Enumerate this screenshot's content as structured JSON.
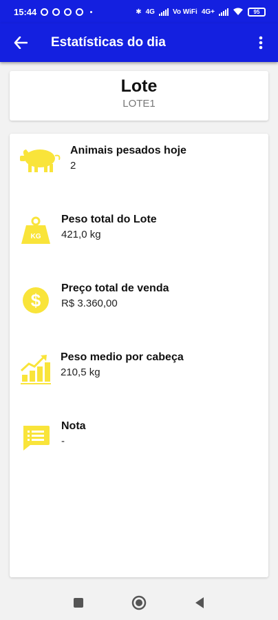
{
  "status_bar": {
    "time": "15:44",
    "network_labels": [
      "4G",
      "Vo WiFi",
      "4G+"
    ],
    "battery": "95"
  },
  "app_bar": {
    "title": "Estatísticas do dia",
    "back_icon": "arrow-left-icon",
    "menu_icon": "more-vert-icon"
  },
  "header_card": {
    "title": "Lote",
    "subtitle": "LOTE1"
  },
  "stats": [
    {
      "icon": "pig-icon",
      "label": "Animais pesados hoje",
      "value": "2"
    },
    {
      "icon": "weight-kg-icon",
      "label": "Peso total do Lote",
      "value": "421,0 kg"
    },
    {
      "icon": "dollar-coin-icon",
      "label": "Preço total de venda",
      "value": "R$ 3.360,00"
    },
    {
      "icon": "growth-chart-icon",
      "label": "Peso medio por cabeça",
      "value": "210,5 kg"
    },
    {
      "icon": "note-icon",
      "label": "Nota",
      "value": "-"
    }
  ],
  "colors": {
    "primary": "#1420e0",
    "icon_yellow": "#f9e43a",
    "background": "#f2f2f2",
    "card": "#ffffff"
  },
  "weight_badge": "KG",
  "nav_bar": {
    "icons": [
      "recents-square-icon",
      "home-circle-icon",
      "back-triangle-icon"
    ]
  }
}
